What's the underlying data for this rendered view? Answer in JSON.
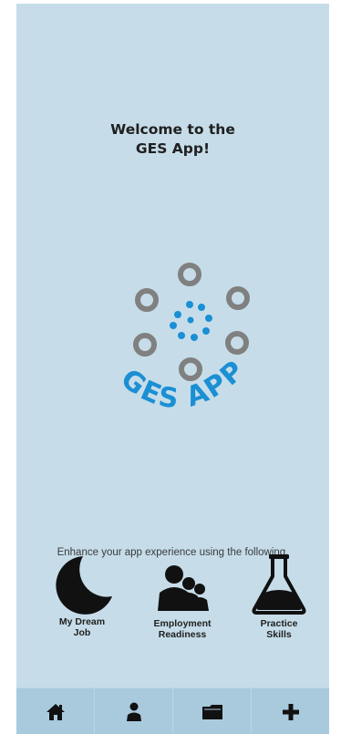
{
  "welcome": {
    "line1": "Welcome to the",
    "line2": "GES App!"
  },
  "logo": {
    "text": "GES APP",
    "icon": "ges-app-logo",
    "colors": {
      "rings": "#808080",
      "dots": "#1b8fd4",
      "text": "#1b8fd4"
    }
  },
  "tagline": "Enhance your app experience using the following.",
  "features": [
    {
      "label": "My Dream\nJob",
      "icon": "moon-icon"
    },
    {
      "label": "Employment\nReadiness",
      "icon": "people-icon"
    },
    {
      "label": "Practice\nSkills",
      "icon": "flask-icon"
    }
  ],
  "nav": [
    {
      "icon": "home-icon"
    },
    {
      "icon": "person-icon"
    },
    {
      "icon": "folder-icon"
    },
    {
      "icon": "plus-icon"
    }
  ],
  "colors": {
    "background": "#c6dde9",
    "navbar": "#a9cadd",
    "icon": "#111111"
  }
}
